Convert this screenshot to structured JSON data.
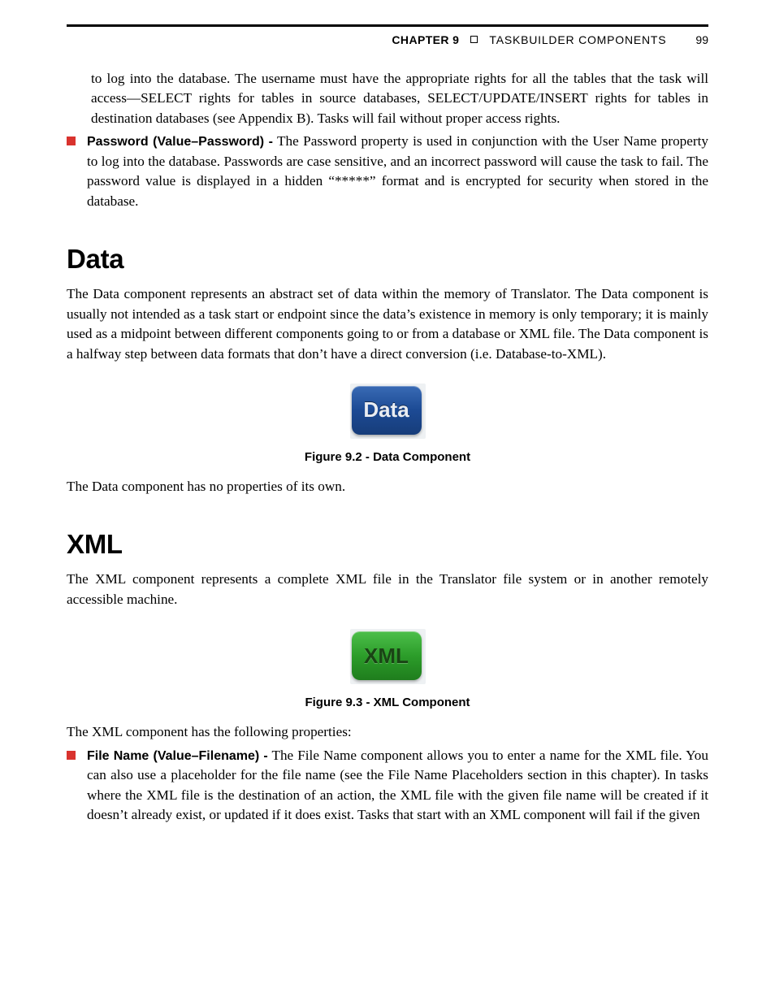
{
  "header": {
    "chapter_label": "CHAPTER 9",
    "chapter_title": "TASKBUILDER COMPONENTS",
    "page_number": "99"
  },
  "intro_continuation": "to log into the database. The username must have the appropriate rights for all the tables that the task will access—SELECT rights for tables in source databases, SELECT/UPDATE/INSERT rights for tables in destination databases (see Appendix B). Tasks will fail without proper access rights.",
  "password_item": {
    "name": "Password (Value–Password) -",
    "desc": " The Password property is used in conjunction with the User Name property to log into the database. Passwords are case sensitive, and an incorrect password will cause the task to fail. The password value is displayed in a hidden “*****” format and is encrypted for security when stored in the database."
  },
  "sections": {
    "data": {
      "heading": "Data",
      "para1": "The Data component represents an abstract set of data within the memory of Translator. The Data component is usually not intended as a task start or endpoint since the data’s existence in memory is only temporary; it is mainly used as a midpoint between different components going to or from a database or XML file. The Data component is a halfway step between data formats that don’t have a direct conversion (i.e. Database-to-XML).",
      "figure_label": "Data",
      "figure_caption": "Figure 9.2 - Data Component",
      "para2": "The Data component has no properties of its own."
    },
    "xml": {
      "heading": "XML",
      "para1": "The XML component represents a complete XML file in the Translator file system or in another remotely accessible machine.",
      "figure_label": "XML",
      "figure_caption": "Figure 9.3 - XML Component",
      "para2": "The XML component has the following properties:",
      "filename_item": {
        "name": "File Name (Value–Filename) -",
        "desc": " The File Name component allows you to enter a name for the XML file. You can also use a placeholder for the file name (see the File Name Placeholders section in this chapter). In tasks where the XML file is the destination of an action, the XML file with the given file name will be created if it doesn’t already exist, or updated if it does exist. Tasks that start with an XML component will fail if the given"
      }
    }
  }
}
